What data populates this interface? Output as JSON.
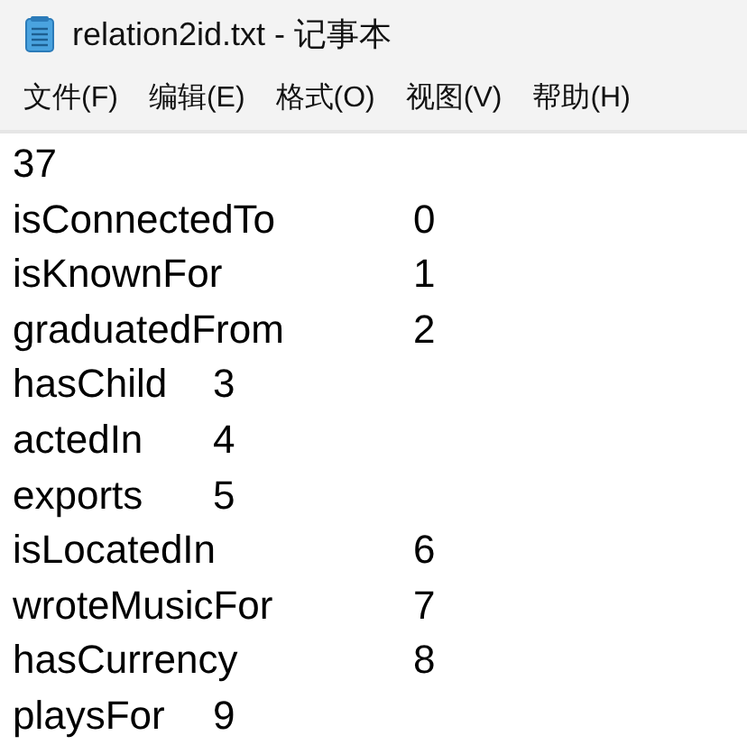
{
  "window": {
    "title": "relation2id.txt - 记事本"
  },
  "menu": [
    "文件(F)",
    "编辑(E)",
    "格式(O)",
    "视图(V)",
    "帮助(H)"
  ],
  "document": {
    "first_line": "37",
    "lines": [
      {
        "relation": "isConnectedTo",
        "id": "0"
      },
      {
        "relation": "isKnownFor",
        "id": "1"
      },
      {
        "relation": "graduatedFrom",
        "id": "2"
      },
      {
        "relation": "hasChild",
        "id": "3"
      },
      {
        "relation": "actedIn",
        "id": "4"
      },
      {
        "relation": "exports",
        "id": "5"
      },
      {
        "relation": "isLocatedIn",
        "id": "6"
      },
      {
        "relation": "wroteMusicFor",
        "id": "7"
      },
      {
        "relation": "hasCurrency",
        "id": "8"
      },
      {
        "relation": "playsFor",
        "id": "9"
      }
    ]
  }
}
